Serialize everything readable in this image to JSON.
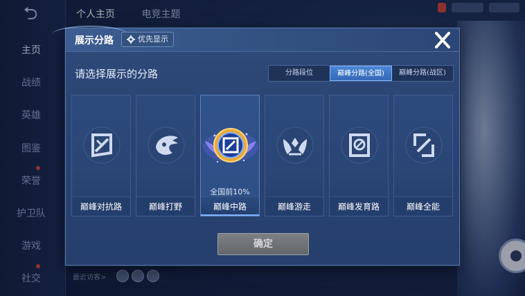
{
  "background": {
    "sidebar": {
      "items": [
        {
          "label": "主页"
        },
        {
          "label": "战绩"
        },
        {
          "label": "英雄"
        },
        {
          "label": "图鉴"
        },
        {
          "label": "荣誉"
        },
        {
          "label": "护卫队"
        },
        {
          "label": "游戏"
        },
        {
          "label": "社交"
        }
      ]
    },
    "tabs": [
      {
        "label": "个人主页"
      },
      {
        "label": "电竞主题"
      }
    ],
    "recent_visitors_label": "最近访客>"
  },
  "dialog": {
    "title": "展示分路",
    "priority_label": "优先显示",
    "subtitle": "请选择展示的分路",
    "segments": [
      {
        "label": "分路段位",
        "active": false
      },
      {
        "label": "巅峰分路(全国)",
        "active": true
      },
      {
        "label": "巅峰分路(战区)",
        "active": false
      }
    ],
    "cards": [
      {
        "label": "巅峰对抗路",
        "icon": "sword-shield-icon",
        "rank": ""
      },
      {
        "label": "巅峰打野",
        "icon": "dragon-icon",
        "rank": ""
      },
      {
        "label": "巅峰中路",
        "icon": "mid-lane-emblem-icon",
        "rank": "全国前10%"
      },
      {
        "label": "巅峰游走",
        "icon": "wings-icon",
        "rank": ""
      },
      {
        "label": "巅峰发育路",
        "icon": "bow-target-icon",
        "rank": ""
      },
      {
        "label": "巅峰全能",
        "icon": "all-round-icon",
        "rank": ""
      }
    ],
    "confirm_label": "确定"
  },
  "colors": {
    "accent": "#3469b8",
    "dialog_bg": "#2a4473",
    "confirm_disabled": "#6d7176"
  }
}
